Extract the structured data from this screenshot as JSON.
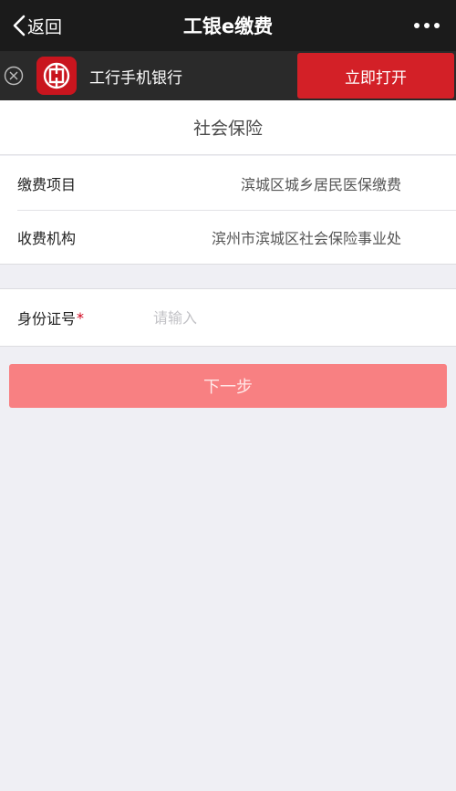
{
  "navbar": {
    "back_label": "返回",
    "title": "工银e缴费",
    "more_icon": "more-dots-icon"
  },
  "app_banner": {
    "close_icon": "close-circle-icon",
    "logo_icon": "icbc-logo-icon",
    "app_name": "工行手机银行",
    "open_label": "立即打开",
    "accent_color": "#d32027"
  },
  "page": {
    "section_title": "社会保险"
  },
  "info": {
    "rows": [
      {
        "label": "缴费项目",
        "value": "滨城区城乡居民医保缴费"
      },
      {
        "label": "收费机构",
        "value": "滨州市滨城区社会保险事业处"
      }
    ]
  },
  "id_field": {
    "label": "身份证号",
    "required_mark": "*",
    "placeholder": "请输入",
    "value": ""
  },
  "actions": {
    "next_label": "下一步",
    "button_color": "#f88082"
  }
}
